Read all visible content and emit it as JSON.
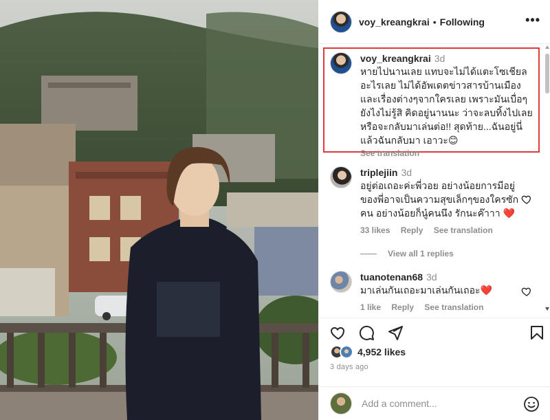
{
  "post": {
    "author": "voy_kreangkrai",
    "follow_status": "Following",
    "separator": "•",
    "more_label": "•••"
  },
  "caption": {
    "author": "voy_kreangkrai",
    "time": "3d",
    "text": "หายไปนานเลย แทบจะไม่ได้แตะโซเชียลอะไรเลย ไม่ได้อัพเดตข่าวสารบ้านเมืองและเรื่องต่างๆจากใครเลย เพราะมันเบื่อๆยังไงไม่รู้สิ คิดอยู่นานนะ ว่าจะลบทิ้งไปเลยหรือจะกลับมาเล่นต่อ!! สุดท้าย...ฉันอยู่นี่แล้วฉันกลับมา เอาวะ😊",
    "see_translation": "See translation",
    "highlight_color": "#e0393e"
  },
  "comments": [
    {
      "author": "triplejiin",
      "time": "3d",
      "text": "อยู่ต่อเถอะค่ะพี่วอย อย่างน้อยการมีอยู่ของพี่อาจเป็นความสุขเล็กๆของใครซักคน อย่างน้อยก็นู๋คนนึง รักนะค๊าาา ❤️",
      "likes": "33 likes",
      "reply": "Reply",
      "see_translation": "See translation",
      "view_replies": "View all 1 replies"
    },
    {
      "author": "tuanotenan68",
      "time": "3d",
      "text": "มาเล่นกันเถอะมาเล่นกันเถอะ❤️",
      "likes": "1 like",
      "reply": "Reply",
      "see_translation": "See translation"
    }
  ],
  "actions": {
    "like_icon": "heart-icon",
    "comment_icon": "comment-icon",
    "share_icon": "share-icon",
    "save_icon": "bookmark-icon"
  },
  "likes_count": "4,952 likes",
  "date": "3 days ago",
  "add_comment": {
    "placeholder": "Add a comment...",
    "emoji_icon": "smiley-icon"
  }
}
